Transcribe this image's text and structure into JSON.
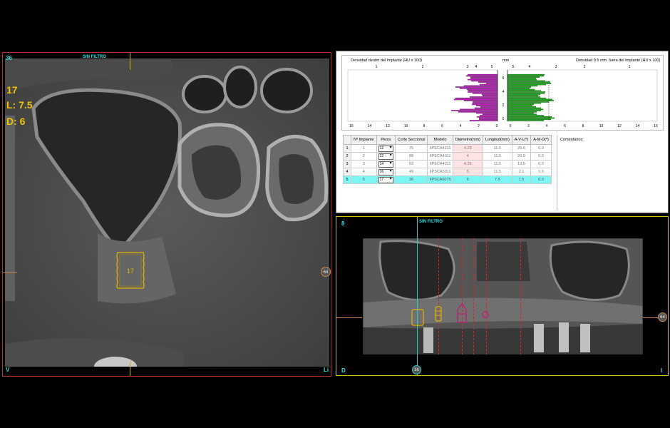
{
  "left_view": {
    "slice_number": "36",
    "filter_label": "SIN FILTRO",
    "info_implant": "17",
    "info_length": "L: 7.5",
    "info_diameter": "D: 6",
    "implant_label": "17",
    "corner_bottom_left": "V",
    "corner_bottom_right": "Li",
    "marker_right": "64"
  },
  "density_panel": {
    "left_chart_title": "Densidad dentro del Implante (HU x 100)",
    "right_chart_title": "Densidad 0.5 mm. fuera del Implante (HU x 100)",
    "mm_label": "mm",
    "colors": {
      "left_bars": "#b21fb2",
      "right_bars": "#1ea51e"
    },
    "left_top_ticks": [
      "1",
      "2",
      "3",
      "4",
      "5"
    ],
    "right_top_ticks": [
      "5",
      "4",
      "3",
      "2",
      "1"
    ],
    "left_bottom_ticks": [
      "16",
      "14",
      "12",
      "10",
      "8",
      "6",
      "4",
      "2",
      "0"
    ],
    "right_bottom_ticks": [
      "0",
      "2",
      "4",
      "6",
      "8",
      "10",
      "12",
      "14",
      "16"
    ],
    "mm_ticks": [
      "0",
      "2",
      "4",
      "6"
    ],
    "table": {
      "headers": [
        "Nº Implante",
        "Pieza",
        "Corte Seccional",
        "Modelo",
        "Diámetro(mm)",
        "Longitud(mm)",
        "A-V-L(º)",
        "A-M-D(º)"
      ],
      "rows": [
        {
          "row": "1",
          "num": "1",
          "pieza": "12",
          "corte": "75",
          "modelo": "IIPECA4211",
          "diam": "4.25",
          "long": "11.5",
          "avl": "25.6",
          "amd": "0.0"
        },
        {
          "row": "2",
          "num": "2",
          "pieza": "22",
          "corte": "88",
          "modelo": "IIPECA4011",
          "diam": "4",
          "long": "11.5",
          "avl": "20.9",
          "amd": "0.0"
        },
        {
          "row": "3",
          "num": "3",
          "pieza": "14",
          "corte": "63",
          "modelo": "IIPECA4211",
          "diam": "4.25",
          "long": "11.5",
          "avl": "19.6",
          "amd": "0.0"
        },
        {
          "row": "4",
          "num": "4",
          "pieza": "16",
          "corte": "49",
          "modelo": "IIPSCA5011",
          "diam": "5",
          "long": "11.5",
          "avl": "2.1",
          "amd": "0.0"
        },
        {
          "row": "5",
          "num": "5",
          "pieza": "17",
          "corte": "36",
          "modelo": "IIPSCA6075",
          "diam": "6",
          "long": "7.5",
          "avl": "1.5",
          "amd": "0.0"
        }
      ]
    },
    "comments_label": "Comentarios:"
  },
  "pano_view": {
    "slice_number": "8",
    "filter_label": "SIN FILTRO",
    "corner_bottom_left": "D",
    "corner_bottom_right": "I",
    "marker_bottom": "36",
    "marker_right": "64"
  }
}
